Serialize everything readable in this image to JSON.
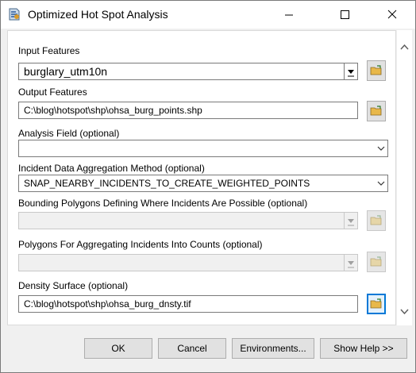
{
  "window": {
    "title": "Optimized Hot Spot Analysis"
  },
  "titlebar_buttons": {
    "minimize": "minimize-icon",
    "maximize": "maximize-icon",
    "close": "close-icon"
  },
  "fields": {
    "input_features": {
      "label": "Input Features",
      "value": "burglary_utm10n"
    },
    "output_features": {
      "label": "Output Features",
      "value": "C:\\blog\\hotspot\\shp\\ohsa_burg_points.shp"
    },
    "analysis_field": {
      "label": "Analysis Field (optional)",
      "value": ""
    },
    "aggregation_method": {
      "label": "Incident Data Aggregation Method (optional)",
      "value": "SNAP_NEARBY_INCIDENTS_TO_CREATE_WEIGHTED_POINTS"
    },
    "bounding_polygons": {
      "label": "Bounding Polygons Defining Where Incidents Are Possible (optional)",
      "value": ""
    },
    "aggregating_polygons": {
      "label": "Polygons For Aggregating Incidents Into Counts (optional)",
      "value": ""
    },
    "density_surface": {
      "label": "Density Surface (optional)",
      "value": "C:\\blog\\hotspot\\shp\\ohsa_burg_dnsty.tif"
    }
  },
  "buttons": {
    "ok": "OK",
    "cancel": "Cancel",
    "environments": "Environments...",
    "show_help": "Show Help >>"
  },
  "colors": {
    "focus_border": "#0078d7",
    "folder_icon": "#e8b84a"
  }
}
